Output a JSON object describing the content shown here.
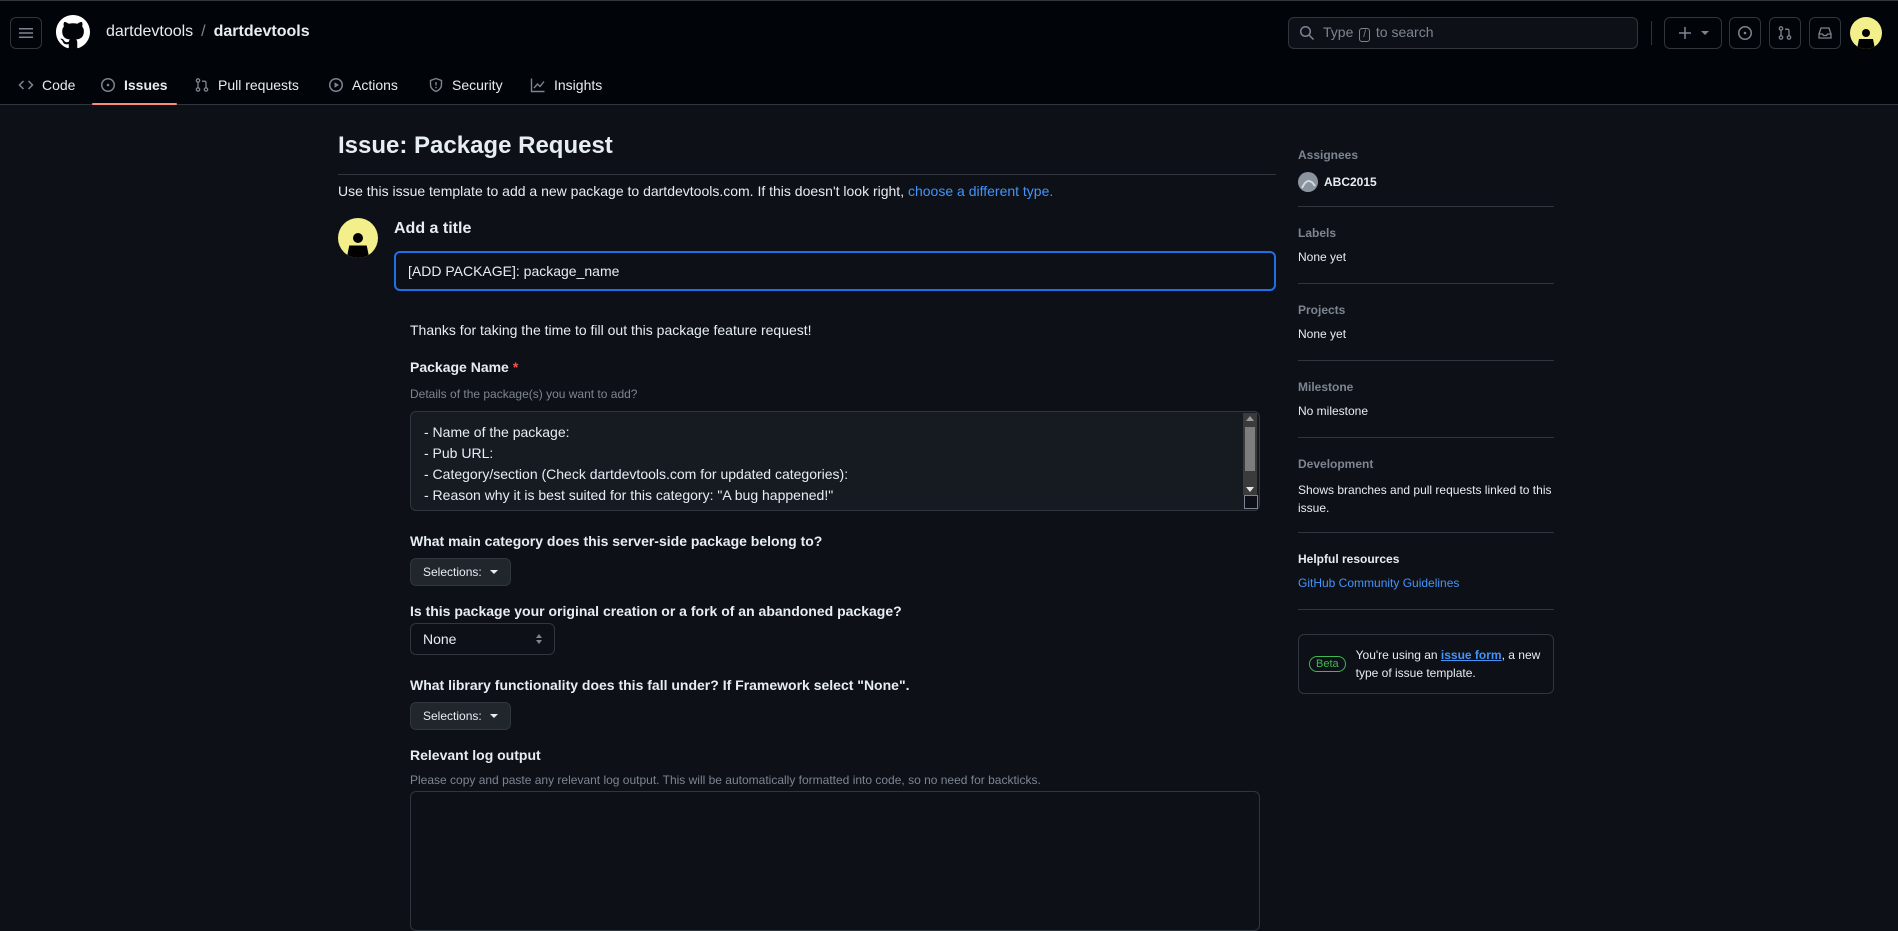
{
  "header": {
    "owner": "dartdevtools",
    "separator": "/",
    "repo": "dartdevtools",
    "search": {
      "prefix": "Type",
      "key": "/",
      "suffix": "to search"
    }
  },
  "tabs": [
    {
      "label": "Code",
      "icon": "code-icon",
      "active": false
    },
    {
      "label": "Issues",
      "icon": "issue-opened-icon",
      "active": true
    },
    {
      "label": "Pull requests",
      "icon": "git-pull-request-icon",
      "active": false
    },
    {
      "label": "Actions",
      "icon": "play-icon",
      "active": false
    },
    {
      "label": "Security",
      "icon": "shield-icon",
      "active": false
    },
    {
      "label": "Insights",
      "icon": "graph-icon",
      "active": false
    }
  ],
  "issue": {
    "page_title": "Issue: Package Request",
    "template_note": "Use this issue template to add a new package to dartdevtools.com. If this doesn't look right,",
    "template_link": "choose a different type.",
    "add_title_label": "Add a title",
    "title_value": "[ADD PACKAGE]: package_name"
  },
  "form": {
    "thanks": "Thanks for taking the time to fill out this package feature request!",
    "package_name": {
      "label": "Package Name",
      "required_mark": "*",
      "help": "Details of the package(s) you want to add?",
      "lines": [
        "- Name of the package:",
        "- Pub URL:",
        "- Category/section (Check dartdevtools.com for updated categories):",
        "- Reason why it is best suited for this category: \"A bug happened!\""
      ]
    },
    "main_category": {
      "label": "What main category does this server-side package belong to?",
      "button": "Selections:"
    },
    "origin": {
      "label": "Is this package your original creation or a fork of an abandoned package?",
      "selected": "None"
    },
    "library": {
      "label": "What library functionality does this fall under? If Framework select \"None\".",
      "button": "Selections:"
    },
    "log": {
      "label": "Relevant log output",
      "help": "Please copy and paste any relevant log output. This will be automatically formatted into code, so no need for backticks."
    }
  },
  "sidebar": {
    "assignees": {
      "heading": "Assignees",
      "value": "ABC2015"
    },
    "labels": {
      "heading": "Labels",
      "value": "None yet"
    },
    "projects": {
      "heading": "Projects",
      "value": "None yet"
    },
    "milestone": {
      "heading": "Milestone",
      "value": "No milestone"
    },
    "development": {
      "heading": "Development",
      "value": "Shows branches and pull requests linked to this issue."
    },
    "helpful": {
      "heading": "Helpful resources",
      "link": "GitHub Community Guidelines"
    },
    "beta": {
      "badge": "Beta",
      "prefix": "You're using an",
      "link": "issue form",
      "suffix": ", a new type of issue template."
    }
  }
}
